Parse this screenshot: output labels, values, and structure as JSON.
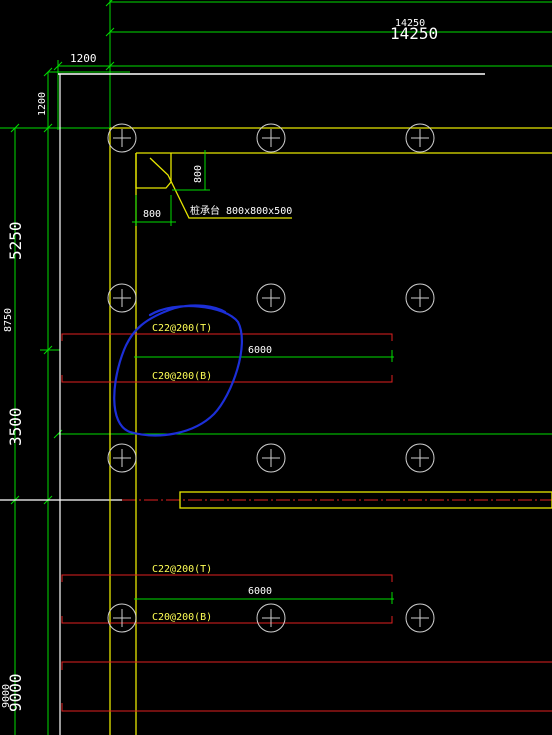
{
  "colors": {
    "background": "#000000",
    "dimension": "#00dd00",
    "wall": "#e6e600",
    "rebar": "#e02020",
    "grid": "#cfcfcf",
    "text": "#ffffff",
    "annotation_text": "#ffff55",
    "markup": "#1c2fd8"
  },
  "dimensions": {
    "top_small": "14250",
    "top_large": "14250",
    "horiz_1200": "1200",
    "vert_1200": "1200",
    "left_5250": "5250",
    "left_8750": "8750",
    "left_3500": "3500",
    "left_9000_small": "9000",
    "left_9000_large": "9000",
    "pile_800_vert": "800",
    "pile_800_horiz": "800"
  },
  "annotations": {
    "pile_cap": "桩承台 800x800x500",
    "rebar_top_1": "C22@200(T)",
    "rebar_bottom_1": "C20@200(B)",
    "span_1": "6000",
    "rebar_top_2": "C22@200(T)",
    "rebar_bottom_2": "C20@200(B)",
    "span_2": "6000"
  },
  "grid_marker_icon": "circle-crosshair-icon",
  "markup_icon": "freehand-circle-markup"
}
